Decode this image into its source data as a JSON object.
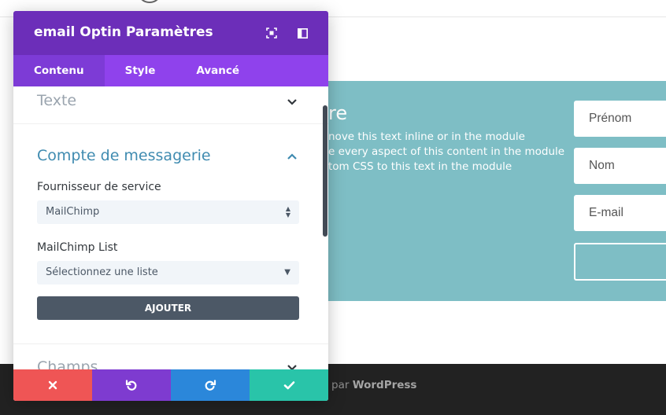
{
  "page": {
    "optin_title": "re",
    "optin_text": [
      "nove this text inline or in the module",
      "e every aspect of this content in the module",
      "tom CSS to this text in the module"
    ],
    "fields": [
      "Prénom",
      "Nom",
      "E-mail"
    ],
    "footer_prefix": "par ",
    "footer_brand": "WordPress"
  },
  "modal": {
    "title": "email Optin Paramètres",
    "header_icons": [
      "expand-icon",
      "sidebar-icon"
    ],
    "tabs": [
      {
        "label": "Contenu",
        "active": true
      },
      {
        "label": "Style",
        "active": false
      },
      {
        "label": "Avancé",
        "active": false
      }
    ],
    "sections": {
      "texte": "Texte",
      "compte": "Compte de messagerie",
      "champs": "Champs"
    },
    "provider_label": "Fournisseur de service",
    "provider_value": "MailChimp",
    "list_label": "MailChimp List",
    "list_value": "Sélectionnez une liste",
    "add_button": "AJOUTER",
    "footer_buttons": [
      "close-icon",
      "undo-icon",
      "redo-icon",
      "check-icon"
    ]
  },
  "colors": {
    "header": "#6c2eb9",
    "tabs": "#8f42ec",
    "optin_bg": "#7ebec5",
    "btn_close": "#ef5555",
    "btn_undo": "#7e3bd0",
    "btn_redo": "#2b87da",
    "btn_save": "#29c4a9"
  }
}
